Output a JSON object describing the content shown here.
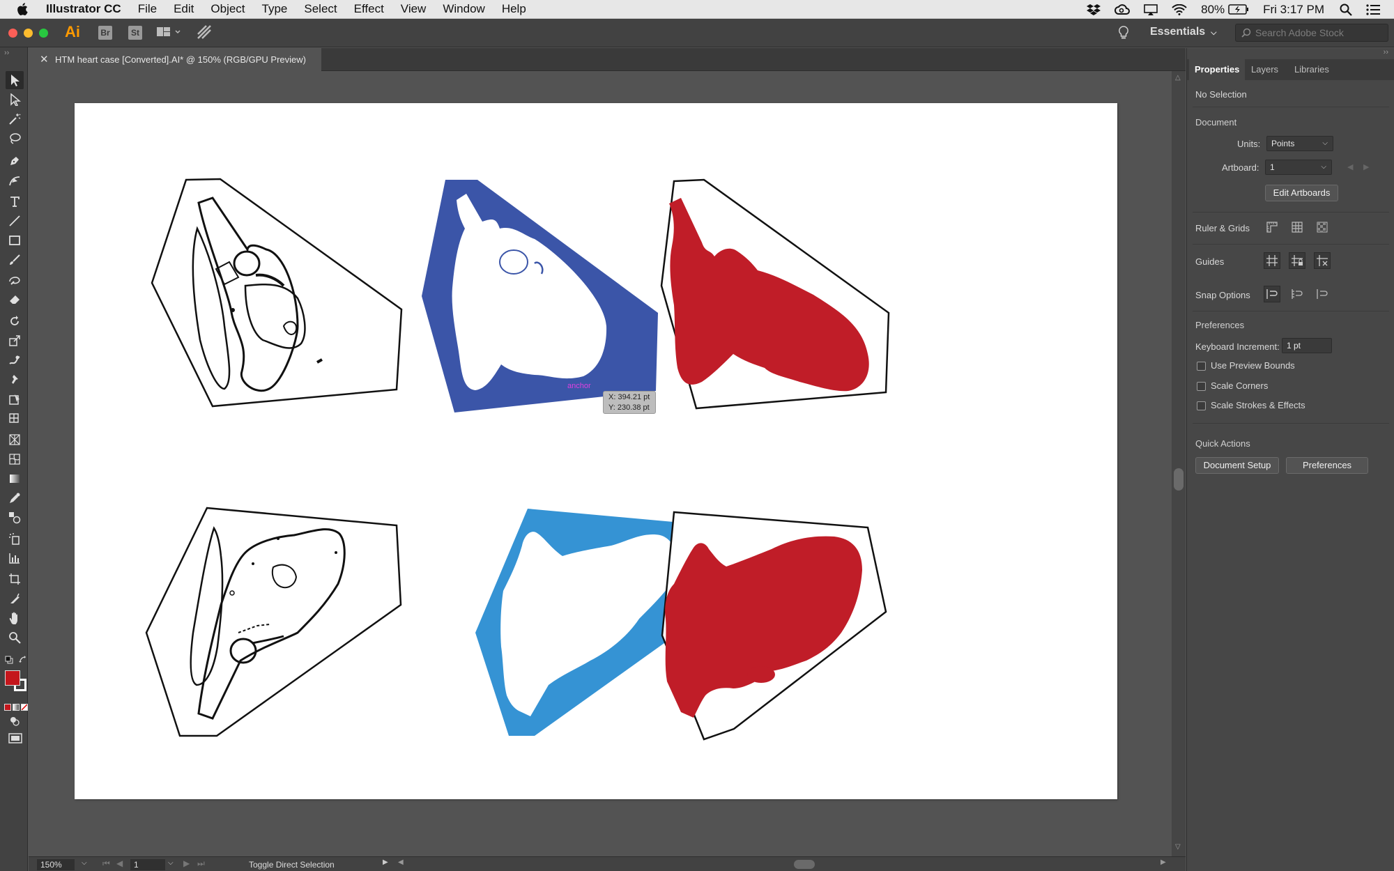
{
  "menubar": {
    "app_name": "Illustrator CC",
    "menus": [
      "File",
      "Edit",
      "Object",
      "Type",
      "Select",
      "Effect",
      "View",
      "Window",
      "Help"
    ],
    "battery": "80%",
    "clock": "Fri 3:17 PM"
  },
  "appbar": {
    "logo": "Ai",
    "bridge_label": "Br",
    "stock_label": "St",
    "workspace": "Essentials",
    "search_placeholder": "Search Adobe Stock"
  },
  "document": {
    "tab_title": "HTM heart case [Converted].AI* @ 150% (RGB/GPU Preview)"
  },
  "canvas": {
    "smart_guide_label": "anchor",
    "coord_x": "X: 394.21 pt",
    "coord_y": "Y: 230.38 pt",
    "colors": {
      "dark_blue": "#3b55a8",
      "light_blue": "#3593d4",
      "red": "#c01d28",
      "outline": "#111111"
    }
  },
  "statusbar": {
    "zoom": "150%",
    "artboard_number": "1",
    "status_text": "Toggle Direct Selection"
  },
  "panel": {
    "tabs": [
      "Properties",
      "Layers",
      "Libraries"
    ],
    "no_selection": "No Selection",
    "document_heading": "Document",
    "units_label": "Units:",
    "units_value": "Points",
    "artboard_label": "Artboard:",
    "artboard_value": "1",
    "edit_artboards": "Edit Artboards",
    "ruler_grids": "Ruler & Grids",
    "guides": "Guides",
    "snap_options": "Snap Options",
    "preferences_heading": "Preferences",
    "keyboard_increment_label": "Keyboard Increment:",
    "keyboard_increment_value": "1 pt",
    "use_preview_bounds": "Use Preview Bounds",
    "scale_corners": "Scale Corners",
    "scale_strokes_effects": "Scale Strokes & Effects",
    "quick_actions": "Quick Actions",
    "document_setup": "Document Setup",
    "preferences_button": "Preferences"
  },
  "toolbar": {
    "fill_color": "#c4161c",
    "stroke_color": "#ffffff"
  }
}
